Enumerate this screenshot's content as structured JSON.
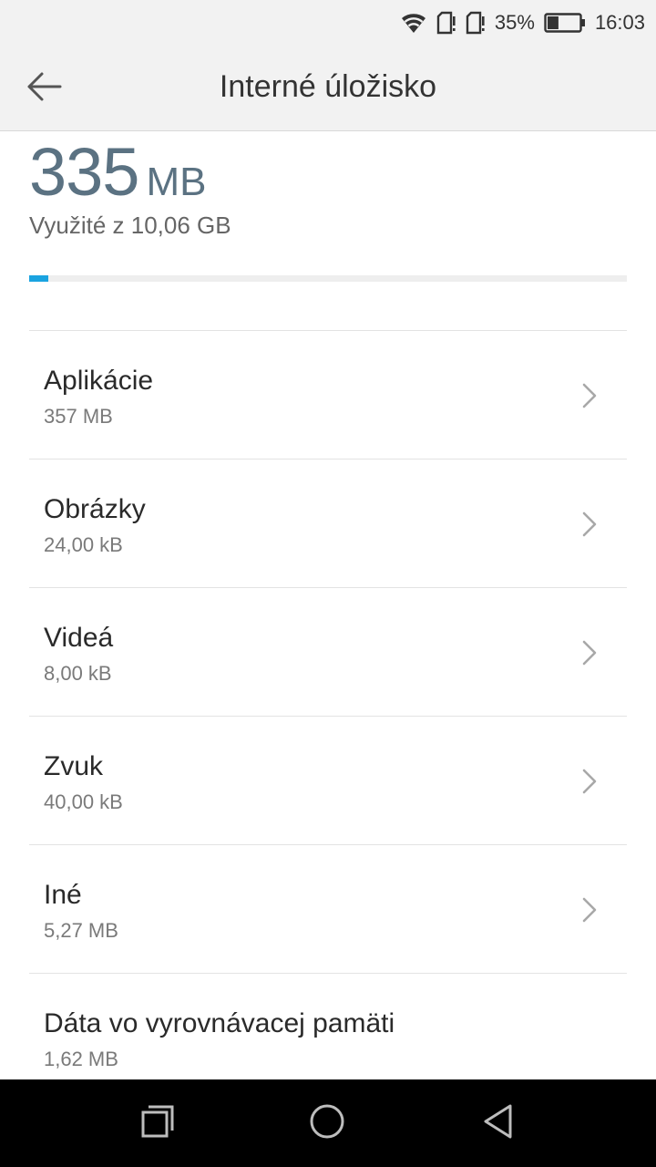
{
  "status_bar": {
    "battery_percent_label": "35%",
    "battery_level": 0.35,
    "time": "16:03",
    "icons": [
      "wifi-icon",
      "sim-card-icon",
      "sim-card-icon",
      "battery-icon"
    ]
  },
  "app_bar": {
    "back_icon": "arrow-left-icon",
    "title": "Interné úložisko"
  },
  "storage_summary": {
    "used_value": "335",
    "used_unit": "MB",
    "used_label": "Využité z 10,06 GB",
    "progress_fraction": 0.032,
    "progress_color": "#1aa3e0"
  },
  "categories": [
    {
      "label": "Aplikácie",
      "size": "357 MB",
      "has_chevron": true
    },
    {
      "label": "Obrázky",
      "size": "24,00 kB",
      "has_chevron": true
    },
    {
      "label": "Videá",
      "size": "8,00 kB",
      "has_chevron": true
    },
    {
      "label": "Zvuk",
      "size": "40,00 kB",
      "has_chevron": true
    },
    {
      "label": "Iné",
      "size": "5,27 MB",
      "has_chevron": true
    },
    {
      "label": "Dáta vo vyrovnávacej pamäti",
      "size": "1,62 MB",
      "has_chevron": false
    }
  ],
  "nav_bar": {
    "buttons": [
      "recents-icon",
      "home-icon",
      "back-triangle-icon"
    ]
  }
}
